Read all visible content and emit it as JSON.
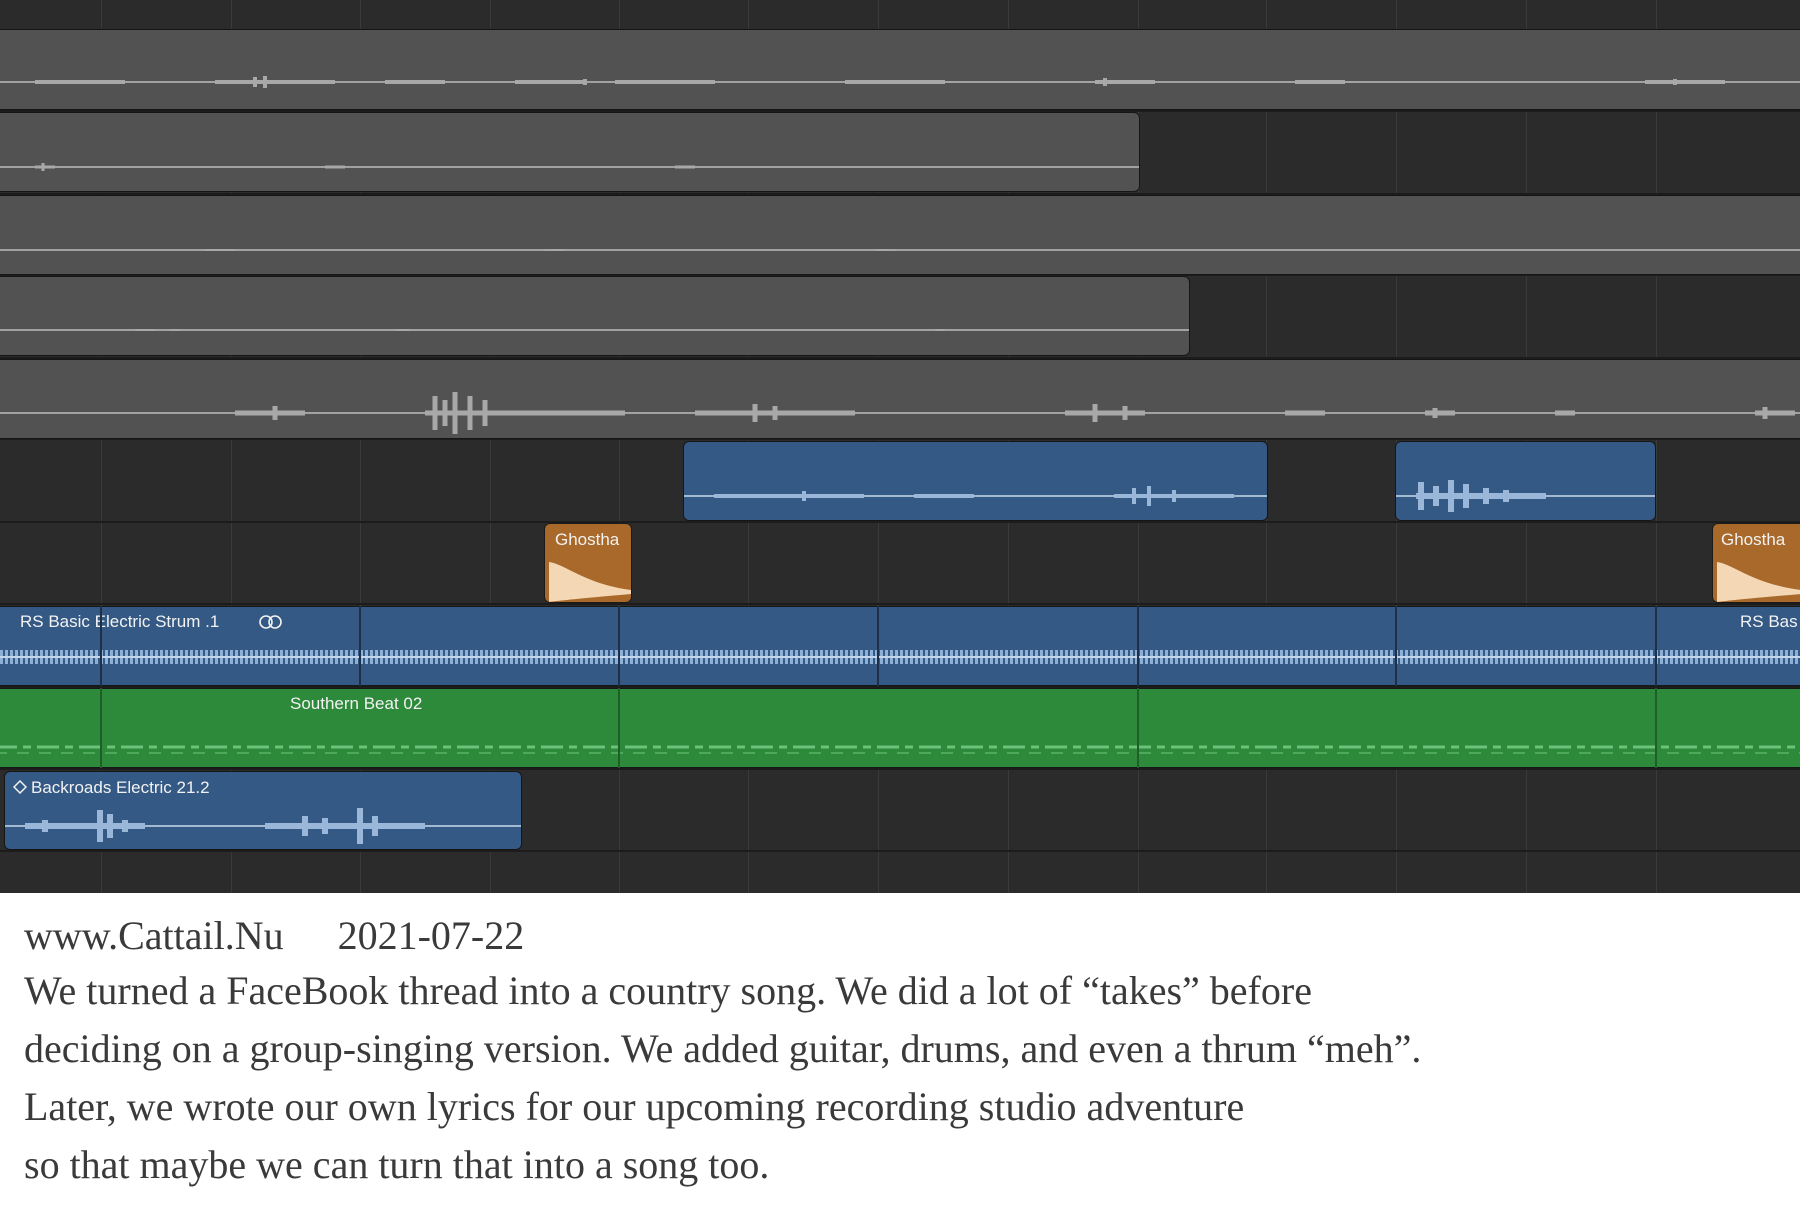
{
  "tracks": {
    "ghost_label_1": "Ghostha",
    "ghost_label_2": "Ghostha",
    "strum_label": "RS Basic Electric Strum .1",
    "strum_label_end": "RS Bas",
    "beat_label": "Southern Beat 02",
    "backroads_label": "Backroads Electric 21.2"
  },
  "icons": {
    "loop": "loop-icon",
    "diamond": "diamond-icon"
  },
  "colors": {
    "background": "#2b2b2b",
    "gray_region": "#525252",
    "blue_region": "#355985",
    "green_region": "#2d8a3a",
    "orange_region": "#a8692a"
  },
  "caption": {
    "site": "www.Cattail.Nu",
    "date": "2021-07-22",
    "lines": [
      "We turned a FaceBook thread into a country song.  We did  a lot of “takes” before",
      "deciding on a group-singing version.  We added guitar, drums, and even a thrum “meh”.",
      "Later, we wrote our own lyrics for our upcoming recording studio adventure",
      "so that maybe we can turn that into a song too."
    ]
  }
}
